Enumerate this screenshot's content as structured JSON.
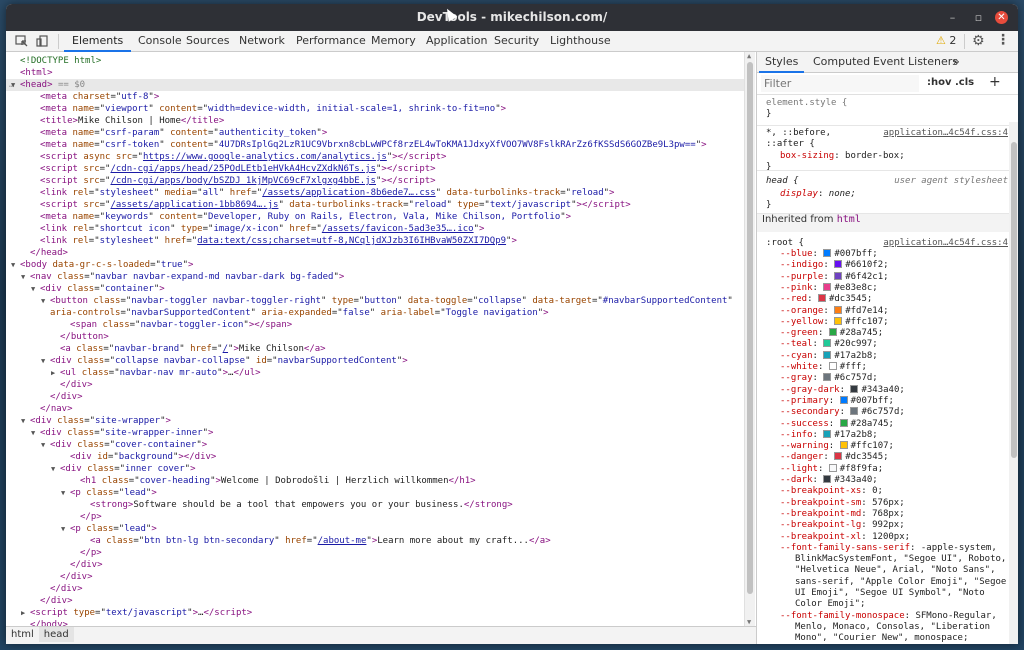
{
  "window": {
    "title": "DevTools - mikechilson.com/",
    "minimize": "–",
    "maximize": "▫",
    "close": "✕"
  },
  "toolbar": {
    "tabs": [
      "Elements",
      "Console",
      "Sources",
      "Network",
      "Performance",
      "Memory",
      "Application",
      "Security",
      "Lighthouse"
    ],
    "warnings": "2",
    "warn_icon": "warning-icon"
  },
  "elements": {
    "lines": [
      {
        "i": 0,
        "h": "<span class='cm'>&lt;!DOCTYPE html&gt;</span>"
      },
      {
        "i": 0,
        "h": "<span class='tg'>&lt;html&gt;</span>"
      },
      {
        "i": 0,
        "t": "▼",
        "hl": true,
        "h": "<span class='tg'>&lt;head&gt;</span> <span class='eq'>== $0</span>"
      },
      {
        "i": 2,
        "h": "<span class='tg'>&lt;meta </span><span class='an'>charset</span>=\"<span class='av'>utf-8</span>\"<span class='tg'>&gt;</span>"
      },
      {
        "i": 2,
        "h": "<span class='tg'>&lt;meta </span><span class='an'>name</span>=\"<span class='av'>viewport</span>\" <span class='an'>content</span>=\"<span class='av'>width=device-width, initial-scale=1, shrink-to-fit=no</span>\"<span class='tg'>&gt;</span>"
      },
      {
        "i": 2,
        "h": "<span class='tg'>&lt;title&gt;</span>Mike Chilson | Home<span class='tg'>&lt;/title&gt;</span>"
      },
      {
        "i": 2,
        "h": "<span class='tg'>&lt;meta </span><span class='an'>name</span>=\"<span class='av'>csrf-param</span>\" <span class='an'>content</span>=\"<span class='av'>authenticity_token</span>\"<span class='tg'>&gt;</span>"
      },
      {
        "i": 2,
        "h": "<span class='tg'>&lt;meta </span><span class='an'>name</span>=\"<span class='av'>csrf-token</span>\" <span class='an'>content</span>=\"<span class='av'>4U7DRsIplGq2LzR1UC9Vbrxn8cbLwWPCf8rzEL4wToKMA1JdxyXfVOO7WV8FslkRArZz6fKSSdS6GOZBe9L3pw==</span>\"<span class='tg'>&gt;</span>"
      },
      {
        "i": 2,
        "h": "<span class='tg'>&lt;script </span><span class='an'>async src</span>=\"<span class='ul'>https://www.google-analytics.com/analytics.js</span>\"<span class='tg'>&gt;&lt;/script&gt;</span>"
      },
      {
        "i": 2,
        "h": "<span class='tg'>&lt;script </span><span class='an'>src</span>=\"<span class='ul'>/cdn-cgi/apps/head/25POdLEtb1eHVkA4HcvZXdkN6Ts.js</span>\"<span class='tg'>&gt;&lt;/script&gt;</span>"
      },
      {
        "i": 2,
        "h": "<span class='tg'>&lt;script </span><span class='an'>src</span>=\"<span class='ul'>/cdn-cgi/apps/body/bSZDJ_1kjMpVC69cF7xlgxg4bbE.js</span>\"<span class='tg'>&gt;&lt;/script&gt;</span>"
      },
      {
        "i": 2,
        "h": "<span class='tg'>&lt;link </span><span class='an'>rel</span>=\"<span class='av'>stylesheet</span>\" <span class='an'>media</span>=\"<span class='av'>all</span>\" <span class='an'>href</span>=\"<span class='ul'>/assets/application-8b6ede7….css</span>\" <span class='an'>data-turbolinks-track</span>=\"<span class='av'>reload</span>\"<span class='tg'>&gt;</span>"
      },
      {
        "i": 2,
        "h": "<span class='tg'>&lt;script </span><span class='an'>src</span>=\"<span class='ul'>/assets/application-1bb8694….js</span>\" <span class='an'>data-turbolinks-track</span>=\"<span class='av'>reload</span>\" <span class='an'>type</span>=\"<span class='av'>text/javascript</span>\"<span class='tg'>&gt;&lt;/script&gt;</span>"
      },
      {
        "i": 2,
        "h": "<span class='tg'>&lt;meta </span><span class='an'>name</span>=\"<span class='av'>keywords</span>\" <span class='an'>content</span>=\"<span class='av'>Developer, Ruby on Rails, Electron, Vala, Mike Chilson, Portfolio</span>\"<span class='tg'>&gt;</span>"
      },
      {
        "i": 2,
        "h": "<span class='tg'>&lt;link </span><span class='an'>rel</span>=\"<span class='av'>shortcut icon</span>\" <span class='an'>type</span>=\"<span class='av'>image/x-icon</span>\" <span class='an'>href</span>=\"<span class='ul'>/assets/favicon-5ad3e35….ico</span>\"<span class='tg'>&gt;</span>"
      },
      {
        "i": 2,
        "h": "<span class='tg'>&lt;link </span><span class='an'>rel</span>=\"<span class='av'>stylesheet</span>\" <span class='an'>href</span>=\"<span class='ul'>data:text/css;charset=utf-8,NCqljdXJzb3I6IHBvaW50ZXI7DQp9</span>\"<span class='tg'>&gt;</span>"
      },
      {
        "i": 1,
        "h": "<span class='tg'>&lt;/head&gt;</span>"
      },
      {
        "i": 0,
        "t": "▼",
        "h": "<span class='tg'>&lt;body </span><span class='an'>data-gr-c-s-loaded</span>=\"<span class='av'>true</span>\"<span class='tg'>&gt;</span>"
      },
      {
        "i": 1,
        "t": "▼",
        "h": "<span class='tg'>&lt;nav </span><span class='an'>class</span>=\"<span class='av'>navbar navbar-expand-md navbar-dark bg-faded</span>\"<span class='tg'>&gt;</span>"
      },
      {
        "i": 2,
        "t": "▼",
        "h": "<span class='tg'>&lt;div </span><span class='an'>class</span>=\"<span class='av'>container</span>\"<span class='tg'>&gt;</span>"
      },
      {
        "i": 3,
        "t": "▼",
        "h": "<span class='tg'>&lt;button </span><span class='an'>class</span>=\"<span class='av'>navbar-toggler navbar-toggler-right</span>\" <span class='an'>type</span>=\"<span class='av'>button</span>\" <span class='an'>data-toggle</span>=\"<span class='av'>collapse</span>\" <span class='an'>data-target</span>=\"<span class='av'>#navbarSupportedContent</span>\""
      },
      {
        "i": 3,
        "h": "<span class='an'>aria-controls</span>=\"<span class='av'>navbarSupportedContent</span>\" <span class='an'>aria-expanded</span>=\"<span class='av'>false</span>\" <span class='an'>aria-label</span>=\"<span class='av'>Toggle navigation</span>\"<span class='tg'>&gt;</span>"
      },
      {
        "i": 5,
        "h": "<span class='tg'>&lt;span </span><span class='an'>class</span>=\"<span class='av'>navbar-toggler-icon</span>\"<span class='tg'>&gt;&lt;/span&gt;</span>"
      },
      {
        "i": 4,
        "h": "<span class='tg'>&lt;/button&gt;</span>"
      },
      {
        "i": 4,
        "h": "<span class='tg'>&lt;a </span><span class='an'>class</span>=\"<span class='av'>navbar-brand</span>\" <span class='an'>href</span>=\"<span class='ul'>/</span>\"<span class='tg'>&gt;</span>Mike Chilson<span class='tg'>&lt;/a&gt;</span>"
      },
      {
        "i": 3,
        "t": "▼",
        "h": "<span class='tg'>&lt;div </span><span class='an'>class</span>=\"<span class='av'>collapse navbar-collapse</span>\" <span class='an'>id</span>=\"<span class='av'>navbarSupportedContent</span>\"<span class='tg'>&gt;</span>"
      },
      {
        "i": 4,
        "t": "▶",
        "h": "<span class='tg'>&lt;ul </span><span class='an'>class</span>=\"<span class='av'>navbar-nav mr-auto</span>\"<span class='tg'>&gt;</span>…<span class='tg'>&lt;/ul&gt;</span>"
      },
      {
        "i": 4,
        "h": "<span class='tg'>&lt;/div&gt;</span>"
      },
      {
        "i": 3,
        "h": "<span class='tg'>&lt;/div&gt;</span>"
      },
      {
        "i": 2,
        "h": "<span class='tg'>&lt;/nav&gt;</span>"
      },
      {
        "i": 1,
        "t": "▼",
        "h": "<span class='tg'>&lt;div </span><span class='an'>class</span>=\"<span class='av'>site-wrapper</span>\"<span class='tg'>&gt;</span>"
      },
      {
        "i": 2,
        "t": "▼",
        "h": "<span class='tg'>&lt;div </span><span class='an'>class</span>=\"<span class='av'>site-wrapper-inner</span>\"<span class='tg'>&gt;</span>"
      },
      {
        "i": 3,
        "t": "▼",
        "h": "<span class='tg'>&lt;div </span><span class='an'>class</span>=\"<span class='av'>cover-container</span>\"<span class='tg'>&gt;</span>"
      },
      {
        "i": 5,
        "h": "<span class='tg'>&lt;div </span><span class='an'>id</span>=\"<span class='av'>background</span>\"<span class='tg'>&gt;&lt;/div&gt;</span>"
      },
      {
        "i": 4,
        "t": "▼",
        "h": "<span class='tg'>&lt;div </span><span class='an'>class</span>=\"<span class='av'>inner cover</span>\"<span class='tg'>&gt;</span>"
      },
      {
        "i": 6,
        "h": "<span class='tg'>&lt;h1 </span><span class='an'>class</span>=\"<span class='av'>cover-heading</span>\"<span class='tg'>&gt;</span>Welcome | Dobrodošli | Herzlich willkommen<span class='tg'>&lt;/h1&gt;</span>"
      },
      {
        "i": 5,
        "t": "▼",
        "h": "<span class='tg'>&lt;p </span><span class='an'>class</span>=\"<span class='av'>lead</span>\"<span class='tg'>&gt;</span>"
      },
      {
        "i": 7,
        "h": "<span class='tg'>&lt;strong&gt;</span>Software should be a tool that empowers you or your business.<span class='tg'>&lt;/strong&gt;</span>"
      },
      {
        "i": 6,
        "h": "<span class='tg'>&lt;/p&gt;</span>"
      },
      {
        "i": 5,
        "t": "▼",
        "h": "<span class='tg'>&lt;p </span><span class='an'>class</span>=\"<span class='av'>lead</span>\"<span class='tg'>&gt;</span>"
      },
      {
        "i": 7,
        "h": "<span class='tg'>&lt;a </span><span class='an'>class</span>=\"<span class='av'>btn btn-lg btn-secondary</span>\" <span class='an'>href</span>=\"<span class='ul'>/about-me</span>\"<span class='tg'>&gt;</span>Learn more about my craft...<span class='tg'>&lt;/a&gt;</span>"
      },
      {
        "i": 6,
        "h": "<span class='tg'>&lt;/p&gt;</span>"
      },
      {
        "i": 5,
        "h": "<span class='tg'>&lt;/div&gt;</span>"
      },
      {
        "i": 4,
        "h": "<span class='tg'>&lt;/div&gt;</span>"
      },
      {
        "i": 3,
        "h": "<span class='tg'>&lt;/div&gt;</span>"
      },
      {
        "i": 2,
        "h": "<span class='tg'>&lt;/div&gt;</span>"
      },
      {
        "i": 1,
        "t": "▶",
        "h": "<span class='tg'>&lt;script </span><span class='an'>type</span>=\"<span class='av'>text/javascript</span>\"<span class='tg'>&gt;</span>…<span class='tg'>&lt;/script&gt;</span>"
      },
      {
        "i": 1,
        "h": "<span class='tg'>&lt;/body&gt;</span>"
      }
    ]
  },
  "breadcrumbs": [
    "html",
    "head"
  ],
  "styles": {
    "tabs": [
      "Styles",
      "Computed",
      "Event Listeners",
      "»"
    ],
    "filter_placeholder": "Filter",
    "hov": ":hov",
    "cls": ".cls",
    "plus": "+",
    "element_style": "element.style {",
    "close_brace": "}",
    "rule1": {
      "sel1": "*, ::before,",
      "sel2": "::after {",
      "src": "application…4c54f.css:4",
      "prop": "box-sizing",
      "val": "border-box;"
    },
    "rule2": {
      "sel": "head {",
      "src": "user agent stylesheet",
      "prop": "display",
      "val": "none;"
    },
    "inherited_label": "Inherited from",
    "inherited_tag": "html",
    "root": {
      "sel": ":root {",
      "src": "application…4c54f.css:4"
    },
    "vars": [
      {
        "n": "--blue",
        "v": "#007bff",
        "c": "#007bff"
      },
      {
        "n": "--indigo",
        "v": "#6610f2",
        "c": "#6610f2"
      },
      {
        "n": "--purple",
        "v": "#6f42c1",
        "c": "#6f42c1"
      },
      {
        "n": "--pink",
        "v": "#e83e8c",
        "c": "#e83e8c"
      },
      {
        "n": "--red",
        "v": "#dc3545",
        "c": "#dc3545"
      },
      {
        "n": "--orange",
        "v": "#fd7e14",
        "c": "#fd7e14"
      },
      {
        "n": "--yellow",
        "v": "#ffc107",
        "c": "#ffc107"
      },
      {
        "n": "--green",
        "v": "#28a745",
        "c": "#28a745"
      },
      {
        "n": "--teal",
        "v": "#20c997",
        "c": "#20c997"
      },
      {
        "n": "--cyan",
        "v": "#17a2b8",
        "c": "#17a2b8"
      },
      {
        "n": "--white",
        "v": "#fff",
        "c": "#ffffff"
      },
      {
        "n": "--gray",
        "v": "#6c757d",
        "c": "#6c757d"
      },
      {
        "n": "--gray-dark",
        "v": "#343a40",
        "c": "#343a40"
      },
      {
        "n": "--primary",
        "v": "#007bff",
        "c": "#007bff"
      },
      {
        "n": "--secondary",
        "v": "#6c757d",
        "c": "#6c757d"
      },
      {
        "n": "--success",
        "v": "#28a745",
        "c": "#28a745"
      },
      {
        "n": "--info",
        "v": "#17a2b8",
        "c": "#17a2b8"
      },
      {
        "n": "--warning",
        "v": "#ffc107",
        "c": "#ffc107"
      },
      {
        "n": "--danger",
        "v": "#dc3545",
        "c": "#dc3545"
      },
      {
        "n": "--light",
        "v": "#f8f9fa",
        "c": "#f8f9fa"
      },
      {
        "n": "--dark",
        "v": "#343a40",
        "c": "#343a40"
      },
      {
        "n": "--breakpoint-xs",
        "v": "0;"
      },
      {
        "n": "--breakpoint-sm",
        "v": "576px;"
      },
      {
        "n": "--breakpoint-md",
        "v": "768px;"
      },
      {
        "n": "--breakpoint-lg",
        "v": "992px;"
      },
      {
        "n": "--breakpoint-xl",
        "v": "1200px;"
      }
    ],
    "font_sans": {
      "n": "--font-family-sans-serif",
      "lines": [
        "-apple-system,",
        "BlinkMacSystemFont, \"Segoe UI\", Roboto,",
        "\"Helvetica Neue\", Arial, \"Noto Sans\",",
        "sans-serif, \"Apple Color Emoji\", \"Segoe",
        "UI Emoji\", \"Segoe UI Symbol\", \"Noto",
        "Color Emoji\";"
      ]
    },
    "font_mono": {
      "n": "--font-family-monospace",
      "lines": [
        "SFMono-Regular,",
        "Menlo, Monaco, Consolas, \"Liberation",
        "Mono\", \"Courier New\", monospace;"
      ]
    }
  }
}
